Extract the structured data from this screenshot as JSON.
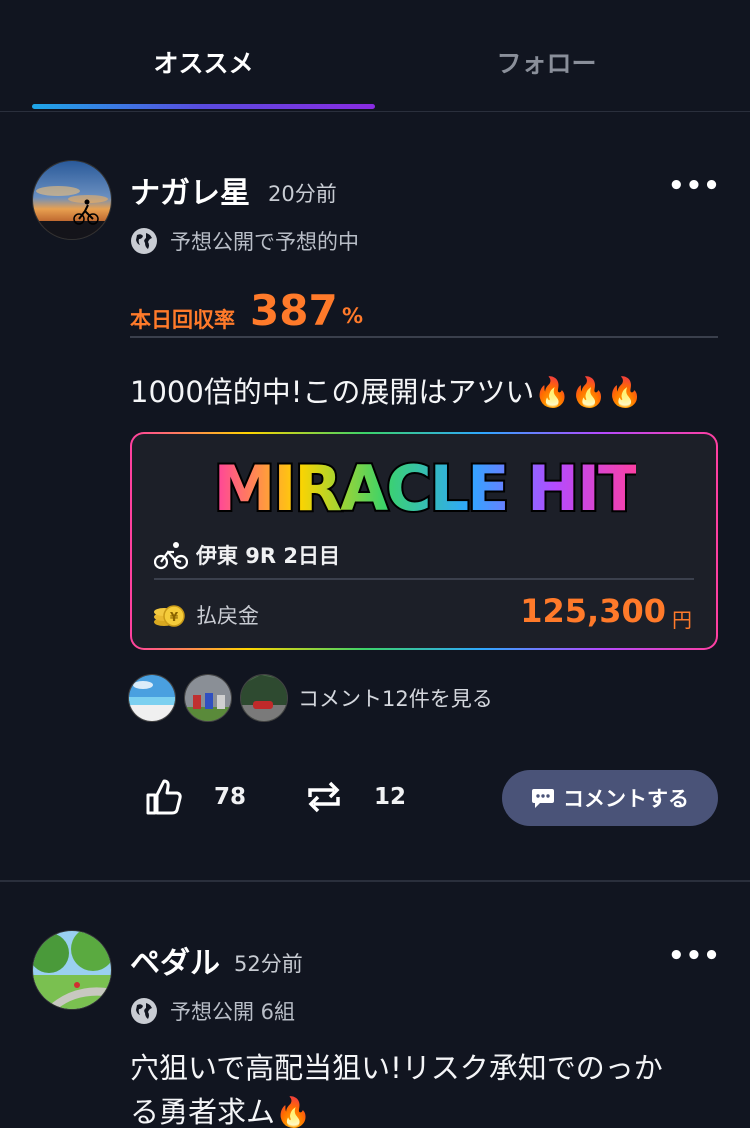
{
  "tabs": [
    {
      "label": "オススメ",
      "active": true
    },
    {
      "label": "フォロー",
      "active": false
    }
  ],
  "posts": [
    {
      "username": "ナガレ星",
      "time": "20分前",
      "meta": "予想公開で予想的中",
      "rate_label": "本日回収率",
      "rate_value": "387",
      "rate_unit": "%",
      "body": "1000倍的中!この展開はアツい🔥🔥🔥",
      "hit": {
        "logo_text": "MIRACLE HIT",
        "race": "伊東 9R 2日目",
        "payout_label": "払戻金",
        "payout_value": "125,300",
        "payout_unit": "円"
      },
      "comment_link": "コメント12件を見る",
      "like_count": "78",
      "repost_count": "12",
      "comment_button": "コメントする",
      "more": "•••"
    },
    {
      "username": "ペダル",
      "time": "52分前",
      "meta": "予想公開 6組",
      "body_line1": "穴狙いで高配当狙い!リスク承知でのっか",
      "body_line2": "る勇者求ム🔥",
      "more": "•••"
    }
  ],
  "colors": {
    "background": "#111520",
    "accent_orange": "#ff7a2a",
    "comment_button": "#4a5378"
  }
}
